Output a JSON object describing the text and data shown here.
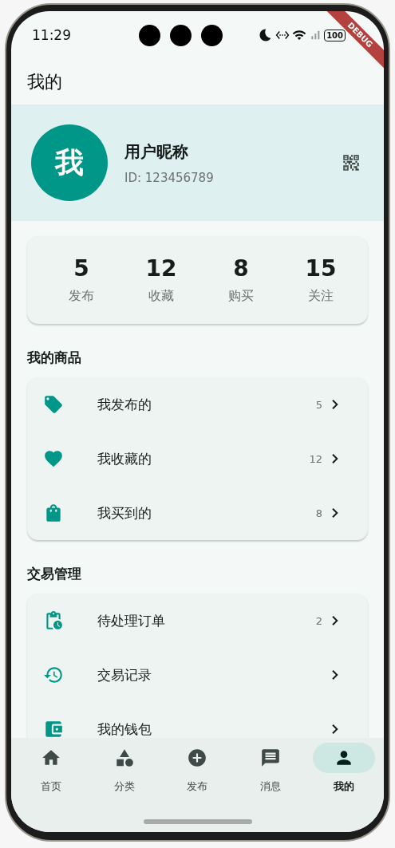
{
  "status_bar": {
    "time": "11:29",
    "battery": "100"
  },
  "debug_banner": "DEBUG",
  "app_bar": {
    "title": "我的"
  },
  "profile": {
    "avatar": "我",
    "nickname": "用户昵称",
    "user_id": "ID: 123456789"
  },
  "stats": [
    {
      "value": "5",
      "label": "发布"
    },
    {
      "value": "12",
      "label": "收藏"
    },
    {
      "value": "8",
      "label": "购买"
    },
    {
      "value": "15",
      "label": "关注"
    }
  ],
  "sections": [
    {
      "title": "我的商品",
      "items": [
        {
          "label": "我发布的",
          "count": "5"
        },
        {
          "label": "我收藏的",
          "count": "12"
        },
        {
          "label": "我买到的",
          "count": "8"
        }
      ]
    },
    {
      "title": "交易管理",
      "items": [
        {
          "label": "待处理订单",
          "count": "2"
        },
        {
          "label": "交易记录"
        },
        {
          "label": "我的钱包"
        }
      ]
    }
  ],
  "bottom_nav": [
    {
      "label": "首页",
      "selected": false
    },
    {
      "label": "分类",
      "selected": false
    },
    {
      "label": "发布",
      "selected": false
    },
    {
      "label": "消息",
      "selected": false
    },
    {
      "label": "我的",
      "selected": true
    }
  ]
}
